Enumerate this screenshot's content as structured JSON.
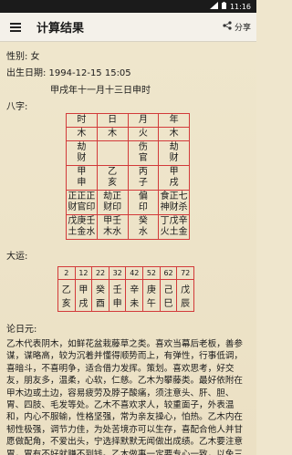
{
  "status": {
    "time": "11:16"
  },
  "appbar": {
    "title": "计算结果",
    "share_label": "分享"
  },
  "info": {
    "gender": "性别: 女",
    "birth": "出生日期: 1994-12-15 15:05",
    "lunar": "甲戌年十一月十三日申时",
    "bazi_label": "八字:",
    "dayun_label": "大运:",
    "lun_label": "论日元:"
  },
  "bazi": {
    "headers": [
      "时",
      "日",
      "月",
      "年"
    ],
    "wuxing": [
      "木",
      "木",
      "火",
      "木"
    ],
    "shishen": [
      [
        "劫",
        "财"
      ],
      [
        "",
        ""
      ],
      [
        "伤",
        "官"
      ],
      [
        "劫",
        "财"
      ]
    ],
    "tiangan": [
      [
        "甲",
        "申"
      ],
      [
        "乙",
        "亥"
      ],
      [
        "丙",
        "子"
      ],
      [
        "甲",
        "戌"
      ]
    ],
    "canggan": [
      [
        "正正正",
        "财官印"
      ],
      [
        "劫正",
        "财印"
      ],
      [
        "偏",
        "印"
      ],
      [
        "食正七",
        "神财杀"
      ]
    ],
    "canggan2": [
      [
        "戊庚壬",
        "土金水"
      ],
      [
        "甲壬",
        "木水"
      ],
      [
        "癸",
        "水"
      ],
      [
        "丁戊辛",
        "火土金"
      ]
    ]
  },
  "dayun": {
    "ages": [
      "2",
      "12",
      "22",
      "32",
      "42",
      "52",
      "62",
      "72"
    ],
    "gan": [
      "乙",
      "甲",
      "癸",
      "壬",
      "辛",
      "庚",
      "己",
      "戊"
    ],
    "zhi": [
      "亥",
      "戌",
      "酉",
      "申",
      "未",
      "午",
      "巳",
      "辰"
    ]
  },
  "lun_text": "乙木代表阴木，如鲜花盆栽藤草之类。喜欢当幕后老板，善参谋，谋略高，较为沉着并懂得顺势而上，有弹性，行事低调，喜暗斗，不喜明争，适合借力发挥。策划。喜欢思考，好交友，朋友多，温柔，心软，仁慈。乙木为攀藤类。最好依附在甲木边或土边，容易疲劳及脖子酸痛，须注意头、肝、胆、胃、四肢、毛发等处。乙木不喜欢求人，较重面子，外表温和，内心不服输，性格坚强，常为亲友操心，怕热。乙木内在韧性极强，调节力佳，为处苦境亦可以生存，喜配合他人并甘愿做配角，不爱出头，宁选择默默无闻做出成绩。乙木要注意胃，胃有不好就赚不到钱。乙木做事一定要专心一致，以免三心两意取舍不定而坐失良机。乙木之女士多数比较漂亮。"
}
